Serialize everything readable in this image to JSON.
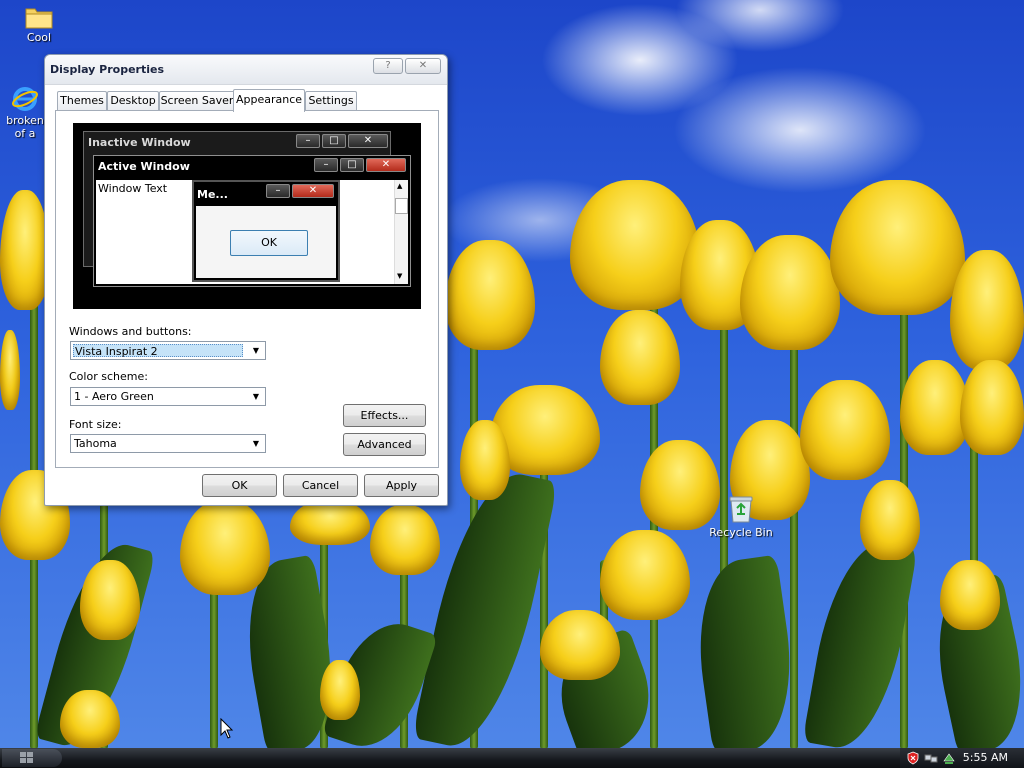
{
  "desktop": {
    "icons": [
      {
        "label": "Cool",
        "icon": "folder-icon"
      },
      {
        "label_line1": "broken",
        "label_line2": "of a",
        "icon": "internet-explorer-icon"
      },
      {
        "label": "Recycle Bin",
        "icon": "recycle-bin-icon"
      }
    ]
  },
  "window": {
    "title": "Display Properties",
    "help_glyph": "?",
    "close_glyph": "✕",
    "tabs": [
      "Themes",
      "Desktop",
      "Screen Saver",
      "Appearance",
      "Settings"
    ],
    "active_tab": "Appearance",
    "preview": {
      "inactive_title": "Inactive Window",
      "active_title": "Active Window",
      "window_text": "Window Text",
      "message_title": "Me...",
      "ok_label": "OK"
    },
    "windows_and_buttons": {
      "label": "Windows and buttons:",
      "value": "Vista Inspirat 2"
    },
    "color_scheme": {
      "label": "Color scheme:",
      "value": "1 - Aero Green"
    },
    "font_size": {
      "label": "Font size:",
      "value": "Tahoma"
    },
    "effects_label": "Effects...",
    "advanced_label": "Advanced",
    "ok_label": "OK",
    "cancel_label": "Cancel",
    "apply_label": "Apply"
  },
  "taskbar": {
    "clock": "5:55 AM",
    "tray_icons": [
      "security-shield-icon",
      "network-icon",
      "safely-remove-icon"
    ]
  },
  "colors": {
    "preview_active_close": "#c9382a",
    "selection_highlight": "#c5e3f8",
    "tulip_yellow": "#f6cf1a",
    "sky_blue": "#2e62dd"
  }
}
